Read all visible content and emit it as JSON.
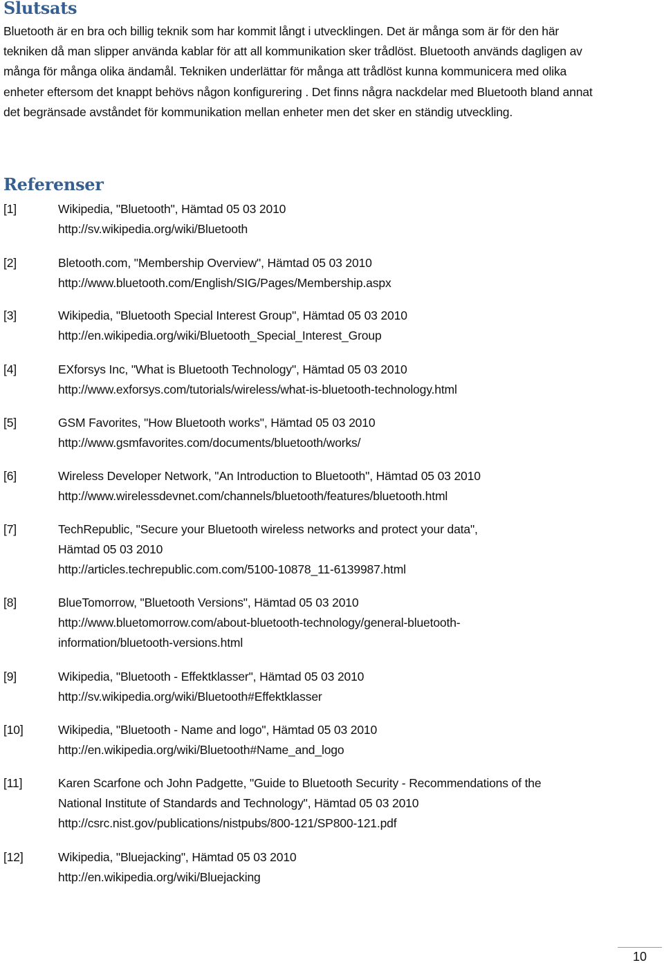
{
  "conclusion": {
    "heading": "Slutsats",
    "paragraph": "Bluetooth är en bra och billig teknik som har kommit långt i utvecklingen. Det är många som är för den här tekniken då man slipper använda kablar för att all kommunikation sker trådlöst. Bluetooth används dagligen av många för många olika ändamål. Tekniken underlättar för många att trådlöst kunna kommunicera med olika enheter eftersom det knappt behövs någon konfigurering . Det finns några nackdelar med Bluetooth bland annat det begränsade avståndet för kommunikation mellan enheter men det sker en ständig utveckling."
  },
  "references": {
    "heading": "Referenser",
    "items": [
      {
        "num": "[1]",
        "lines": [
          "Wikipedia, \"Bluetooth\", Hämtad 05 03 2010"
        ],
        "url": "http://sv.wikipedia.org/wiki/Bluetooth"
      },
      {
        "num": "[2]",
        "lines": [
          "Bletooth.com, \"Membership Overview\", Hämtad 05 03 2010"
        ],
        "url": "http://www.bluetooth.com/English/SIG/Pages/Membership.aspx"
      },
      {
        "num": "[3]",
        "lines": [
          "Wikipedia, \"Bluetooth Special Interest Group\", Hämtad 05 03 2010"
        ],
        "url": "http://en.wikipedia.org/wiki/Bluetooth_Special_Interest_Group"
      },
      {
        "num": "[4]",
        "lines": [
          "EXforsys Inc, \"What is Bluetooth Technology\", Hämtad 05 03 2010"
        ],
        "url": "http://www.exforsys.com/tutorials/wireless/what-is-bluetooth-technology.html"
      },
      {
        "num": "[5]",
        "lines": [
          "GSM Favorites, \"How Bluetooth works\", Hämtad 05 03 2010"
        ],
        "url": "http://www.gsmfavorites.com/documents/bluetooth/works/"
      },
      {
        "num": "[6]",
        "lines": [
          "Wireless Developer Network, \"An Introduction to Bluetooth\", Hämtad 05 03 2010"
        ],
        "url": "http://www.wirelessdevnet.com/channels/bluetooth/features/bluetooth.html"
      },
      {
        "num": "[7]",
        "lines": [
          "TechRepublic, \"Secure your Bluetooth wireless networks and protect your data\",",
          "Hämtad 05 03 2010"
        ],
        "url": "http://articles.techrepublic.com.com/5100-10878_11-6139987.html"
      },
      {
        "num": "[8]",
        "lines": [
          "BlueTomorrow, \"Bluetooth Versions\", Hämtad 05 03 2010"
        ],
        "url_lines": [
          "http://www.bluetomorrow.com/about-bluetooth-technology/general-bluetooth-",
          "information/bluetooth-versions.html"
        ]
      },
      {
        "num": "[9]",
        "lines": [
          "Wikipedia, \"Bluetooth - Effektklasser\", Hämtad 05 03 2010"
        ],
        "url": "http://sv.wikipedia.org/wiki/Bluetooth#Effektklasser"
      },
      {
        "num": "[10]",
        "lines": [
          "Wikipedia, \"Bluetooth - Name and logo\", Hämtad 05 03 2010"
        ],
        "url": "http://en.wikipedia.org/wiki/Bluetooth#Name_and_logo"
      },
      {
        "num": "[11]",
        "lines": [
          " Karen Scarfone och John Padgette, \"Guide to Bluetooth Security - Recommendations of the",
          "National Institute of Standards and Technology\", Hämtad 05 03 2010"
        ],
        "url": "http://csrc.nist.gov/publications/nistpubs/800-121/SP800-121.pdf"
      },
      {
        "num": "[12]",
        "lines": [
          "Wikipedia, \"Bluejacking\", Hämtad 05 03 2010"
        ],
        "url": "http://en.wikipedia.org/wiki/Bluejacking"
      }
    ]
  },
  "footer": {
    "page_number": "10"
  }
}
